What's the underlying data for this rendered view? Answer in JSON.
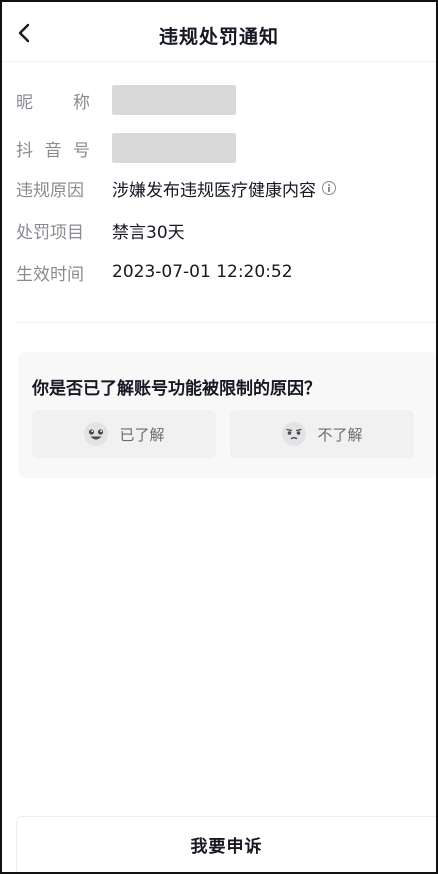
{
  "header": {
    "title": "违规处罚通知",
    "back_icon": "chevron-left-icon"
  },
  "info": {
    "nickname_label_chars": [
      "昵",
      "称"
    ],
    "douyin_id_label_chars": [
      "抖",
      "音",
      "号"
    ],
    "violation_reason_label": "违规原因",
    "violation_reason_value": "涉嫌发布违规医疗健康内容",
    "penalty_item_label": "处罚项目",
    "penalty_item_value": "禁言30天",
    "effective_time_label": "生效时间",
    "effective_time_value": "2023-07-01 12:20:52"
  },
  "feedback": {
    "question": "你是否已了解账号功能被限制的原因？",
    "option_yes": "已了解",
    "option_no": "不了解"
  },
  "footer": {
    "appeal_label": "我要申诉"
  },
  "colors": {
    "text_primary": "#161823",
    "text_secondary": "#8a8b91",
    "mask_gray": "#d9d9d9",
    "card_bg": "#f8f8f8"
  }
}
